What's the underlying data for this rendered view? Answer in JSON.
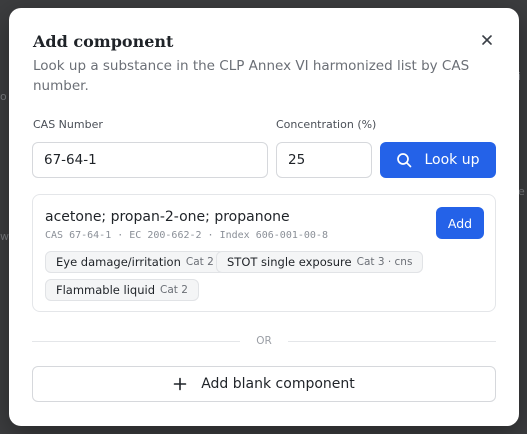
{
  "dialog": {
    "title": "Add component",
    "subtitle": "Look up a substance in the CLP Annex VI harmonized list by CAS number.",
    "close_icon": "close-icon"
  },
  "form": {
    "cas_label": "CAS Number",
    "cas_value": "67-64-1",
    "concentration_label": "Concentration (%)",
    "concentration_value": "25",
    "lookup_label": "Look up",
    "lookup_icon": "search-icon"
  },
  "result": {
    "name": "acetone; propan-2-one; propanone",
    "identifiers": "CAS 67-64-1 · EC 200-662-2 · Index 606-001-00-8",
    "add_label": "Add",
    "hazards": [
      {
        "name": "Eye damage/irritation",
        "category": "Cat 2"
      },
      {
        "name": "STOT single exposure",
        "category": "Cat 3 · cns"
      },
      {
        "name": "Flammable liquid",
        "category": "Cat 2"
      }
    ]
  },
  "separator_label": "OR",
  "blank_button": {
    "label": "Add blank component",
    "icon": "plus-icon"
  },
  "colors": {
    "accent": "#2462e8",
    "backdrop": "#3c3d3f"
  }
}
